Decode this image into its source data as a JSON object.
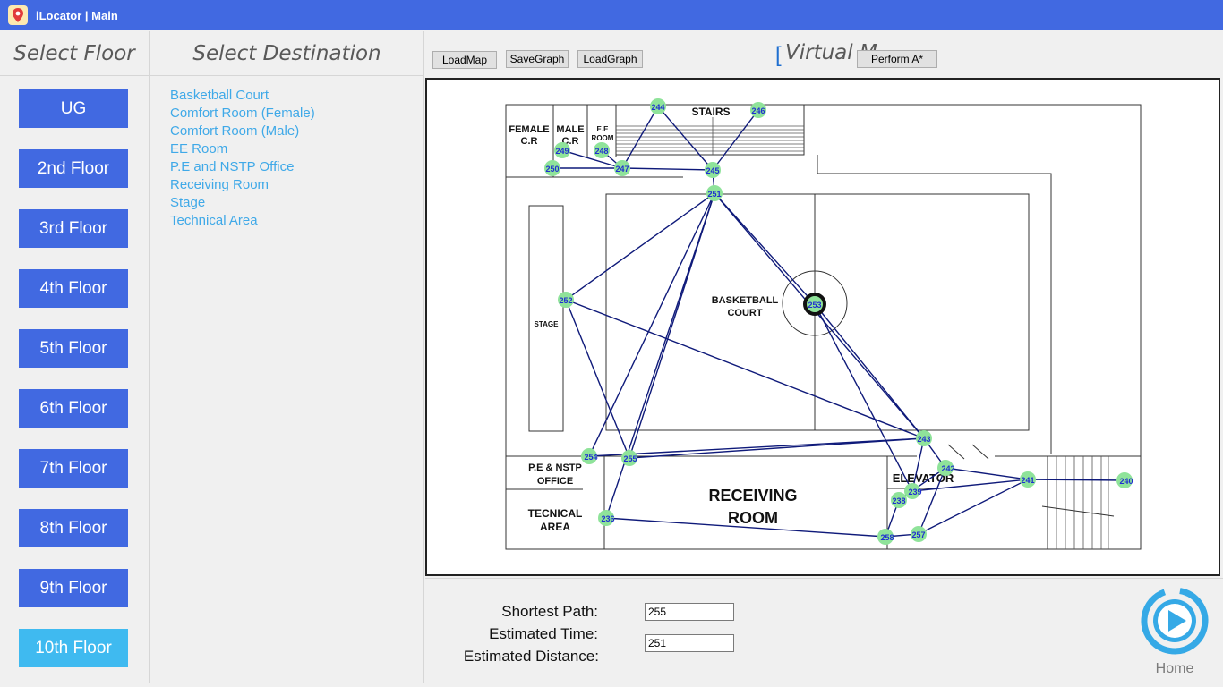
{
  "window": {
    "title": "iLocator | Main",
    "icon": "map-pin-icon",
    "accent": "#4169e1"
  },
  "floors": {
    "header": "Select Floor",
    "items": [
      "UG",
      "2nd Floor",
      "3rd Floor",
      "4th Floor",
      "5th Floor",
      "6th Floor",
      "7th Floor",
      "8th Floor",
      "9th Floor",
      "10th Floor"
    ],
    "selected": "10th Floor",
    "selected_color": "#3fbaf0"
  },
  "destinations": {
    "header": "Select Destination",
    "items": [
      "Basketball Court",
      "Comfort Room (Female)",
      "Comfort Room (Male)",
      "EE Room",
      "P.E and NSTP Office",
      "Receiving Room",
      "Stage",
      "Technical Area"
    ],
    "color": "#3fa9e8"
  },
  "toolbar": {
    "load_map": "LoadMap",
    "save_graph": "SaveGraph",
    "load_graph": "LoadGraph",
    "perform": "Perform A*",
    "view_title": "Virtual M"
  },
  "map": {
    "rooms": {
      "female_cr": [
        "FEMALE",
        "C.R"
      ],
      "male_cr": [
        "MALE",
        "C.R"
      ],
      "ee_room": [
        "E.E",
        "ROOM"
      ],
      "stairs": "STAIRS",
      "basketball_court": [
        "BASKETBALL",
        "COURT"
      ],
      "stage": "STAGE",
      "pe_office": [
        "P.E & NSTP",
        "OFFICE"
      ],
      "technical_area": [
        "TECNICAL",
        "AREA"
      ],
      "receiving_room": [
        "RECEIVING",
        "ROOM"
      ],
      "elevator": "ELEVATOR"
    },
    "nodes": [
      "244",
      "246",
      "249",
      "248",
      "250",
      "247",
      "245",
      "251",
      "252",
      "253",
      "243",
      "242",
      "241",
      "240",
      "254",
      "255",
      "239",
      "238",
      "236",
      "258",
      "257"
    ],
    "node_color": "#8fe39a",
    "edge_color": "#0f1a7a"
  },
  "results": {
    "shortest_path_label": "Shortest Path:",
    "shortest_path_value": "255",
    "time_label": "Estimated Time:",
    "time_value": "251",
    "distance_label": "Estimated Distance:",
    "distance_value": "",
    "home_label": "Home",
    "home_icon": "play-icon"
  }
}
